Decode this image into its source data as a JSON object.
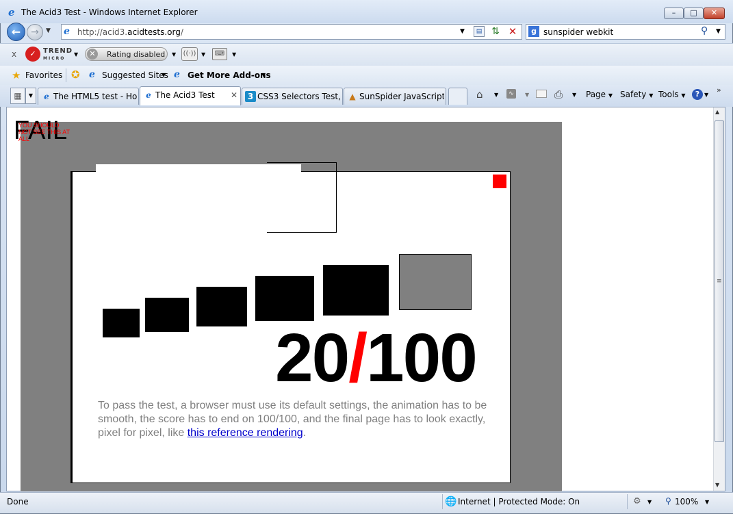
{
  "window": {
    "title": "The Acid3 Test - Windows Internet Explorer",
    "min_label": "–",
    "max_label": "□",
    "close_label": "✕"
  },
  "address": {
    "url_prefix": "http://acid3.",
    "url_domain": "acidtests.org",
    "url_suffix": "/"
  },
  "search": {
    "value": "sunspider webkit",
    "logo_letter": "g"
  },
  "toolbar": {
    "trend_line1": "TREND",
    "trend_line2": "MICRO",
    "rating_label": "Rating disabled",
    "close_label": "x"
  },
  "favorites": {
    "label": "Favorites",
    "suggested_label": "Suggested Sites",
    "addons_label": "Get More Add-ons"
  },
  "tabs": [
    {
      "label": "The HTML5 test - Ho...",
      "icon": "e",
      "active": false
    },
    {
      "label": "The Acid3 Test",
      "icon": "e",
      "active": true
    },
    {
      "label": "CSS3 Selectors Test, ...",
      "icon": "3",
      "active": false
    },
    {
      "label": "SunSpider JavaScript ...",
      "icon": "▲",
      "active": false
    }
  ],
  "commandbar": {
    "page_label": "Page",
    "safety_label": "Safety",
    "tools_label": "Tools"
  },
  "acid3": {
    "fail_label": "FAIL",
    "fail_warning": "YOU SHOULD NOT SEE THIS AT ALL",
    "score": "20",
    "slash": "/",
    "total": "100",
    "instructions": "To pass the test, a browser must use its default settings, the animation has to be smooth, the score has to end on 100/100, and the final page has to look exactly, pixel for pixel, like ",
    "link_text": "this reference rendering",
    "instructions_end": "."
  },
  "status": {
    "text": "Done",
    "zone": "Internet | Protected Mode: On",
    "zoom": "100%"
  },
  "icons": {
    "back": "back-arrow-icon",
    "forward": "forward-arrow-icon",
    "refresh": "refresh-icon",
    "stop": "stop-icon",
    "home": "home-icon",
    "feeds": "feeds-icon",
    "print": "print-icon",
    "help": "help-icon"
  },
  "colors": {
    "score_slash": "#ff0000",
    "link": "#0000cc",
    "gray_area": "#808080"
  }
}
